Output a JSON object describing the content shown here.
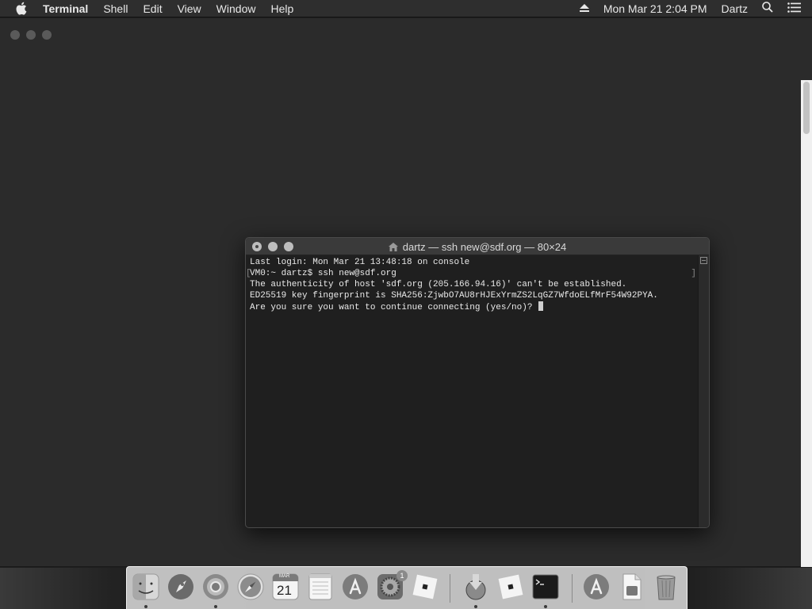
{
  "menubar": {
    "app_name": "Terminal",
    "items": [
      "Shell",
      "Edit",
      "View",
      "Window",
      "Help"
    ],
    "datetime": "Mon Mar 21  2:04 PM",
    "user": "Dartz"
  },
  "terminal": {
    "title": "dartz — ssh new@sdf.org — 80×24",
    "lines": [
      "Last login: Mon Mar 21 13:48:18 on console",
      "VM0:~ dartz$ ssh new@sdf.org",
      "The authenticity of host 'sdf.org (205.166.94.16)' can't be established.",
      "ED25519 key fingerprint is SHA256:ZjwbO7AU8rHJExYrmZS2LqGZ7WfdoELfMrF54W92PYA.",
      "Are you sure you want to continue connecting (yes/no)? "
    ]
  },
  "dock": {
    "calendar_month": "MAR",
    "calendar_day": "21",
    "settings_badge": "1",
    "apps": [
      "finder",
      "launchpad",
      "chrome",
      "safari",
      "calendar",
      "notes",
      "app-store",
      "system-preferences",
      "roblox",
      "installer",
      "roblox",
      "terminal",
      "app-store",
      "document",
      "trash"
    ]
  },
  "colors": {
    "menubar_bg": "#2e2e2e",
    "window_bg": "#2b2b2b",
    "terminal_bg": "#1f1f1f",
    "dock_bg": "#d7d7d7"
  }
}
